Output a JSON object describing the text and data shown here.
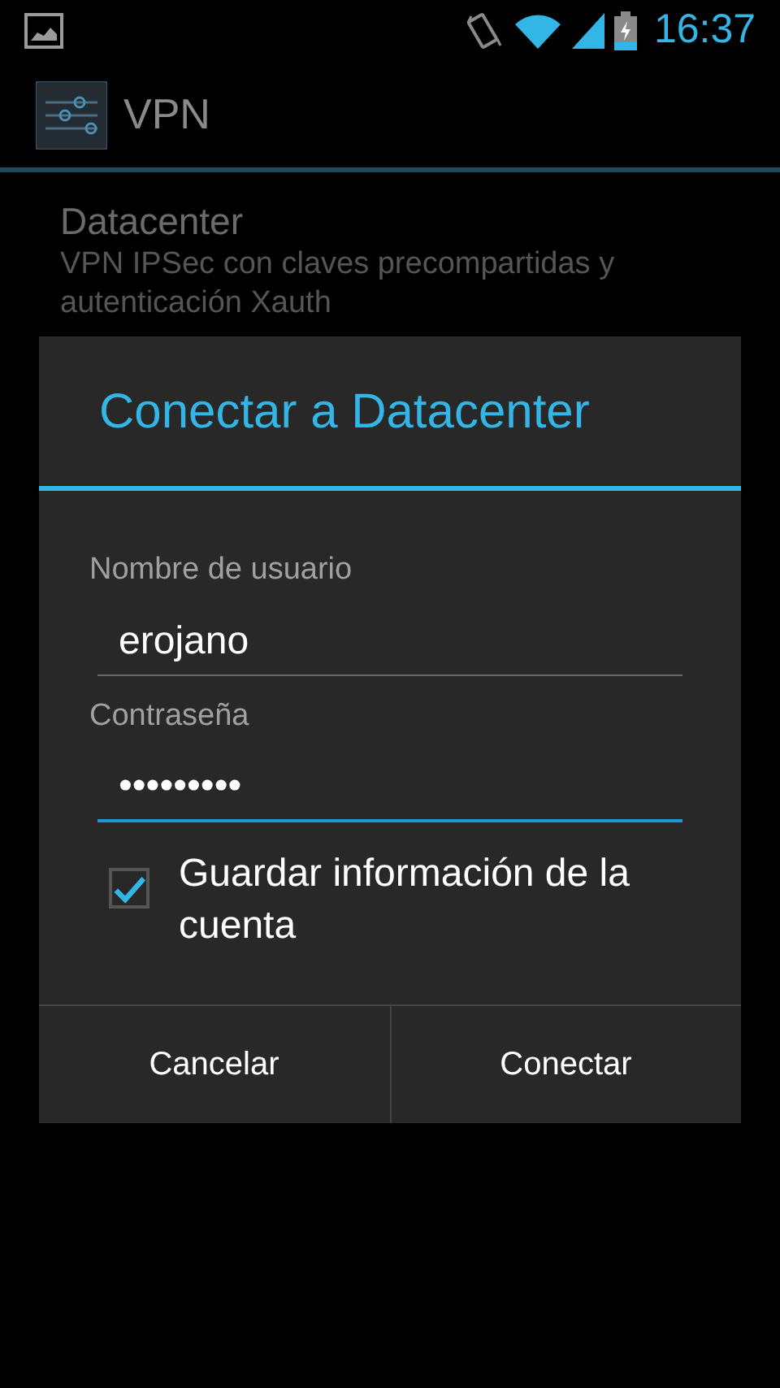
{
  "status_bar": {
    "time": "16:37"
  },
  "action_bar": {
    "title": "VPN"
  },
  "vpn_item": {
    "name": "Datacenter",
    "description": "VPN IPSec con claves precompartidas y autenticación Xauth"
  },
  "dialog": {
    "title": "Conectar a Datacenter",
    "fields": [
      {
        "label": "Nombre de usuario",
        "value": "erojano",
        "focused": false
      },
      {
        "label": "Contraseña",
        "value": "•••••••••",
        "focused": true
      }
    ],
    "checkbox": {
      "label": "Guardar información de la cuenta",
      "checked": true
    },
    "buttons": [
      "Cancelar",
      "Conectar"
    ]
  }
}
